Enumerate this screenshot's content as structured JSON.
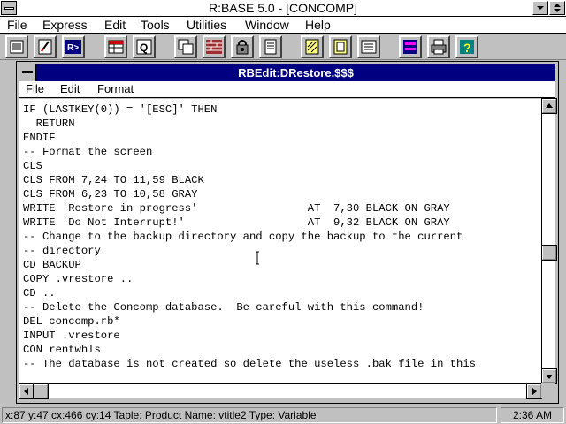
{
  "app": {
    "title": "R:BASE 5.0 - [CONCOMP]"
  },
  "menubar": {
    "items": [
      {
        "label": "File"
      },
      {
        "label": "Express"
      },
      {
        "label": "Edit"
      },
      {
        "label": "Tools"
      },
      {
        "label": "Utilities"
      },
      {
        "label": "Window"
      },
      {
        "label": "Help"
      }
    ]
  },
  "toolbar": {
    "icons": [
      "database-icon",
      "edit-pencil-icon",
      "rbase-prompt-icon",
      "table-icon",
      "query-icon",
      "forms-icon",
      "brick-icon",
      "lock-icon",
      "report-icon",
      "script-icon",
      "document-icon",
      "window-icon",
      "printer-icon",
      "help-icon"
    ]
  },
  "child": {
    "title": "RBEdit:DRestore.$$$",
    "menu": [
      {
        "label": "File"
      },
      {
        "label": "Edit"
      },
      {
        "label": "Format"
      }
    ]
  },
  "editor": {
    "lines": [
      "IF (LASTKEY(0)) = '[ESC]' THEN",
      "  RETURN",
      "ENDIF",
      "-- Format the screen",
      "CLS",
      "CLS FROM 7,24 TO 11,59 BLACK",
      "CLS FROM 6,23 TO 10,58 GRAY",
      "WRITE 'Restore in progress'                 AT  7,30 BLACK ON GRAY",
      "WRITE 'Do Not Interrupt!'                   AT  9,32 BLACK ON GRAY",
      "-- Change to the backup directory and copy the backup to the current",
      "-- directory",
      "CD BACKUP",
      "COPY .vrestore ..",
      "CD ..",
      "-- Delete the Concomp database.  Be careful with this command!",
      "DEL concomp.rb*",
      "INPUT .vrestore",
      "CON rentwhls",
      "-- The database is not created so delete the useless .bak file in this"
    ]
  },
  "statusbar": {
    "text": "x:87 y:47 cx:466 cy:14 Table: Product Name: vtitle2 Type: Variable",
    "time": "2:36 AM"
  }
}
